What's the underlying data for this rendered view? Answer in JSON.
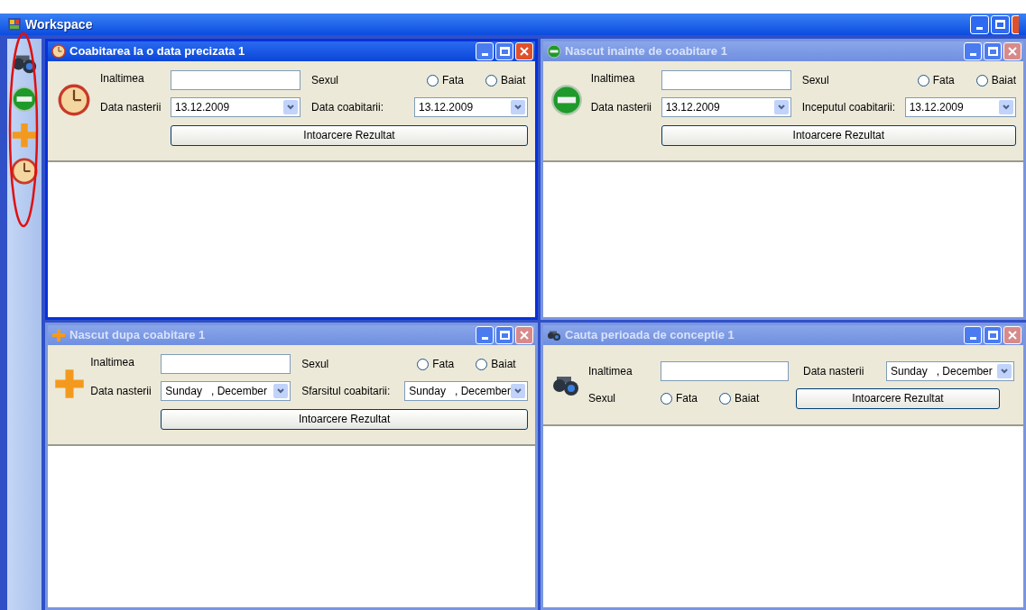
{
  "window": {
    "title": "Workspace"
  },
  "toolbar": [
    {
      "kind": "binoculars"
    },
    {
      "kind": "stop"
    },
    {
      "kind": "plus"
    },
    {
      "kind": "clock"
    }
  ],
  "child_windows": [
    {
      "title": "Coabitarea la o data precizata 1",
      "kind": "clock",
      "active": true,
      "height_label": "Inaltimea",
      "sex_label": "Sexul",
      "radios": [
        {
          "label": "Fata",
          "selected": false
        },
        {
          "label": "Baiat",
          "selected": false
        }
      ],
      "birth_label": "Data nasterii",
      "birth_value": "13.12.2009",
      "second_label": "Data coabitarii:",
      "second_value": "13.12.2009",
      "button": "Intoarcere Rezultat"
    },
    {
      "title": "Nascut inainte de coabitare 1",
      "kind": "stop",
      "active": false,
      "height_label": "Inaltimea",
      "sex_label": "Sexul",
      "radios": [
        {
          "label": "Fata",
          "selected": false
        },
        {
          "label": "Baiat",
          "selected": false
        }
      ],
      "birth_label": "Data nasterii",
      "birth_value": "13.12.2009",
      "second_label": "Inceputul coabitarii:",
      "second_value": "13.12.2009",
      "button": "Intoarcere Rezultat"
    },
    {
      "title": "Nascut dupa coabitare 1",
      "kind": "plus",
      "active": false,
      "height_label": "Inaltimea",
      "sex_label": "Sexul",
      "radios": [
        {
          "label": "Fata",
          "selected": false
        },
        {
          "label": "Baiat",
          "selected": false
        }
      ],
      "birth_label": "Data nasterii",
      "birth_value": "Sunday   , December",
      "second_label": "Sfarsitul coabitarii:",
      "second_value": "Sunday   , December",
      "button": "Intoarcere Rezultat"
    },
    {
      "title": "Cauta perioada de conceptie 1",
      "kind": "binoculars",
      "active": false,
      "height_label": "Inaltimea",
      "sex_label": "Sexul",
      "radios": [
        {
          "label": "Fata",
          "selected": false
        },
        {
          "label": "Baiat",
          "selected": false
        }
      ],
      "birth_label": "Data nasterii",
      "birth_value": "Sunday   , December",
      "button": "Intoarcere Rezultat"
    }
  ]
}
